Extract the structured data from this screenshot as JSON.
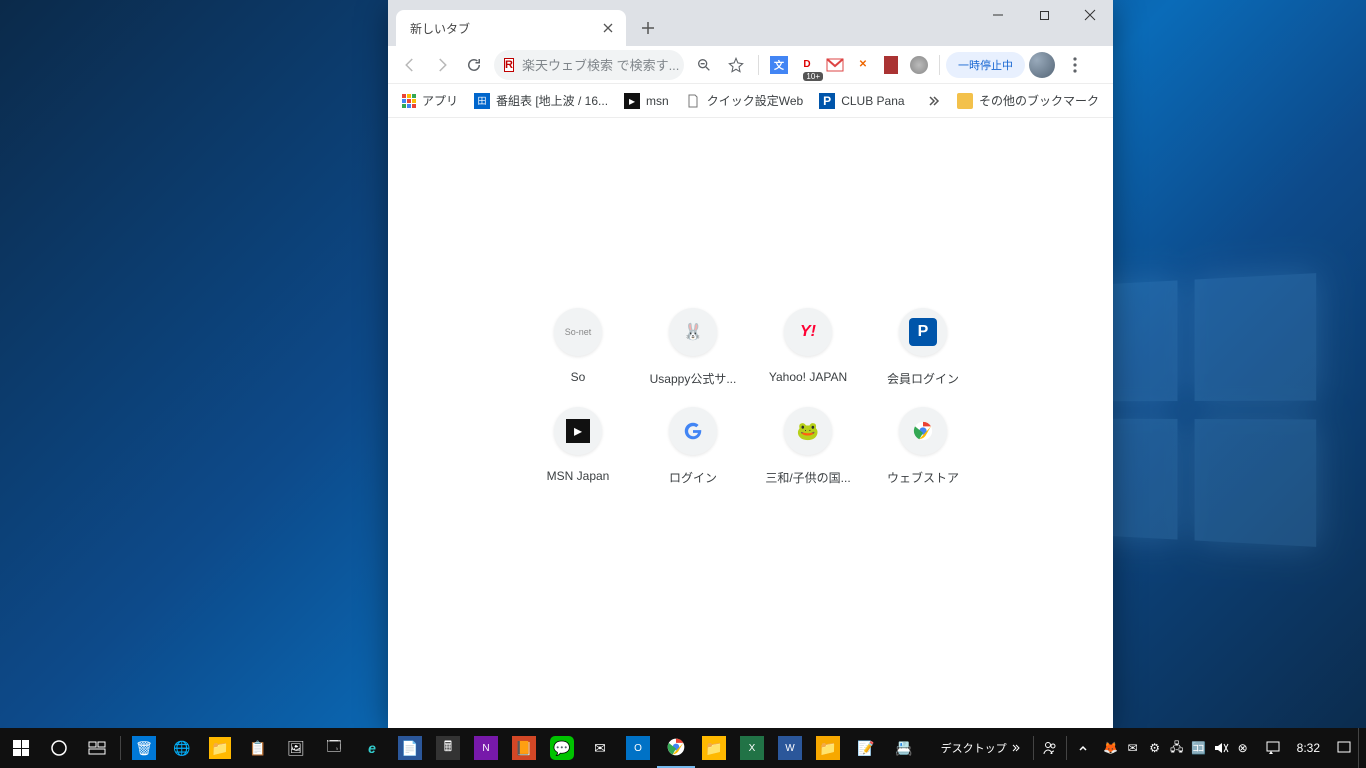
{
  "tab": {
    "title": "新しいタブ"
  },
  "omnibox": {
    "placeholder": "楽天ウェブ検索 で検索す..."
  },
  "ext_badge": "10+",
  "pause_label": "一時停止中",
  "bookmarks": {
    "apps": "アプリ",
    "items": [
      {
        "label": "番組表 [地上波 / 16...",
        "icon": "tv"
      },
      {
        "label": "msn",
        "icon": "msn"
      },
      {
        "label": "クイック設定Web",
        "icon": "page"
      },
      {
        "label": "CLUB Pana",
        "icon": "p"
      }
    ],
    "other": "その他のブックマーク"
  },
  "tiles": [
    {
      "label": "So",
      "icon": "sonet"
    },
    {
      "label": "Usappy公式サ...",
      "icon": "usappy"
    },
    {
      "label": "Yahoo! JAPAN",
      "icon": "yahoo"
    },
    {
      "label": "会員ログイン",
      "icon": "p"
    },
    {
      "label": "MSN Japan",
      "icon": "msn"
    },
    {
      "label": "ログイン",
      "icon": "google"
    },
    {
      "label": "三和/子供の国...",
      "icon": "frog"
    },
    {
      "label": "ウェブストア",
      "icon": "chrome"
    }
  ],
  "taskbar": {
    "desktop_label": "デスクトップ",
    "clock": "8:32"
  }
}
